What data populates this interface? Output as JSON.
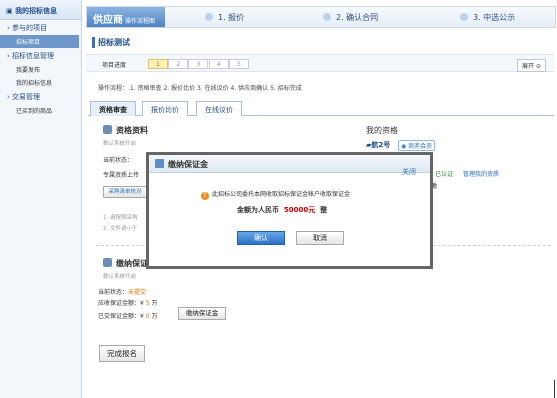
{
  "sidebar": {
    "header": "我的招标信息",
    "groups": [
      {
        "label": "参与的项目",
        "items": [
          "招标项目"
        ]
      },
      {
        "label": "招标信息管理",
        "items": [
          "我要发布",
          "我的招标信息"
        ]
      },
      {
        "label": "交易管理",
        "items": [
          "已买到的商品"
        ]
      }
    ]
  },
  "topbar": {
    "brand": "供应商",
    "brand_sub": "操作流程图",
    "steps": [
      "1. 报价",
      "2. 确认合同",
      "3. 中选公示"
    ]
  },
  "page": {
    "title": "招标测试",
    "progress_label": "项目进度",
    "progress_steps": [
      "1",
      "2",
      "3",
      "4",
      "5"
    ],
    "expand": "展开",
    "flow": "操作流程：  1. 资格审查   2. 报价比价   3. 在线议价   4. 供应商确认   5. 招标完成",
    "tabs": [
      "资格审查",
      "报价比价",
      "在线议价"
    ]
  },
  "qualification": {
    "title": "资格资料",
    "note": "数认系统开启",
    "status_label": "当前状态：",
    "line2": "专属资质上传",
    "button": "采购清单核对",
    "list1": "1. 请按照采购",
    "list2": "2. 文件请小于"
  },
  "my_qual": {
    "title": "我的资格",
    "name": "航2号",
    "badge": "商务会员",
    "verified": "已认证",
    "manage": "管理我的资质",
    "extra": "缴"
  },
  "deposit": {
    "title": "缴纳保证金",
    "note": "数认系统开启",
    "status_label": "当前状态：",
    "status": "未提交",
    "due_label": "应收保证金额：¥",
    "due": "5",
    "due_unit": "万",
    "paid_label": "已交保证金额：¥",
    "paid": "0",
    "paid_unit": "万",
    "pay_button": "缴纳保证金"
  },
  "finish_button": "完成报名",
  "modal": {
    "title": "缴纳保证金",
    "close": "关闭",
    "message": "此招标公司委托本网收取招标保证金帐户收取保证金",
    "amount_prefix": "金额为人民币",
    "amount": "50000元",
    "amount_suffix": "整",
    "ok": "确认",
    "cancel": "取消"
  },
  "colors": {
    "accent": "#2e72c7",
    "warn": "#f08a1c",
    "amount": "#cc0000"
  }
}
